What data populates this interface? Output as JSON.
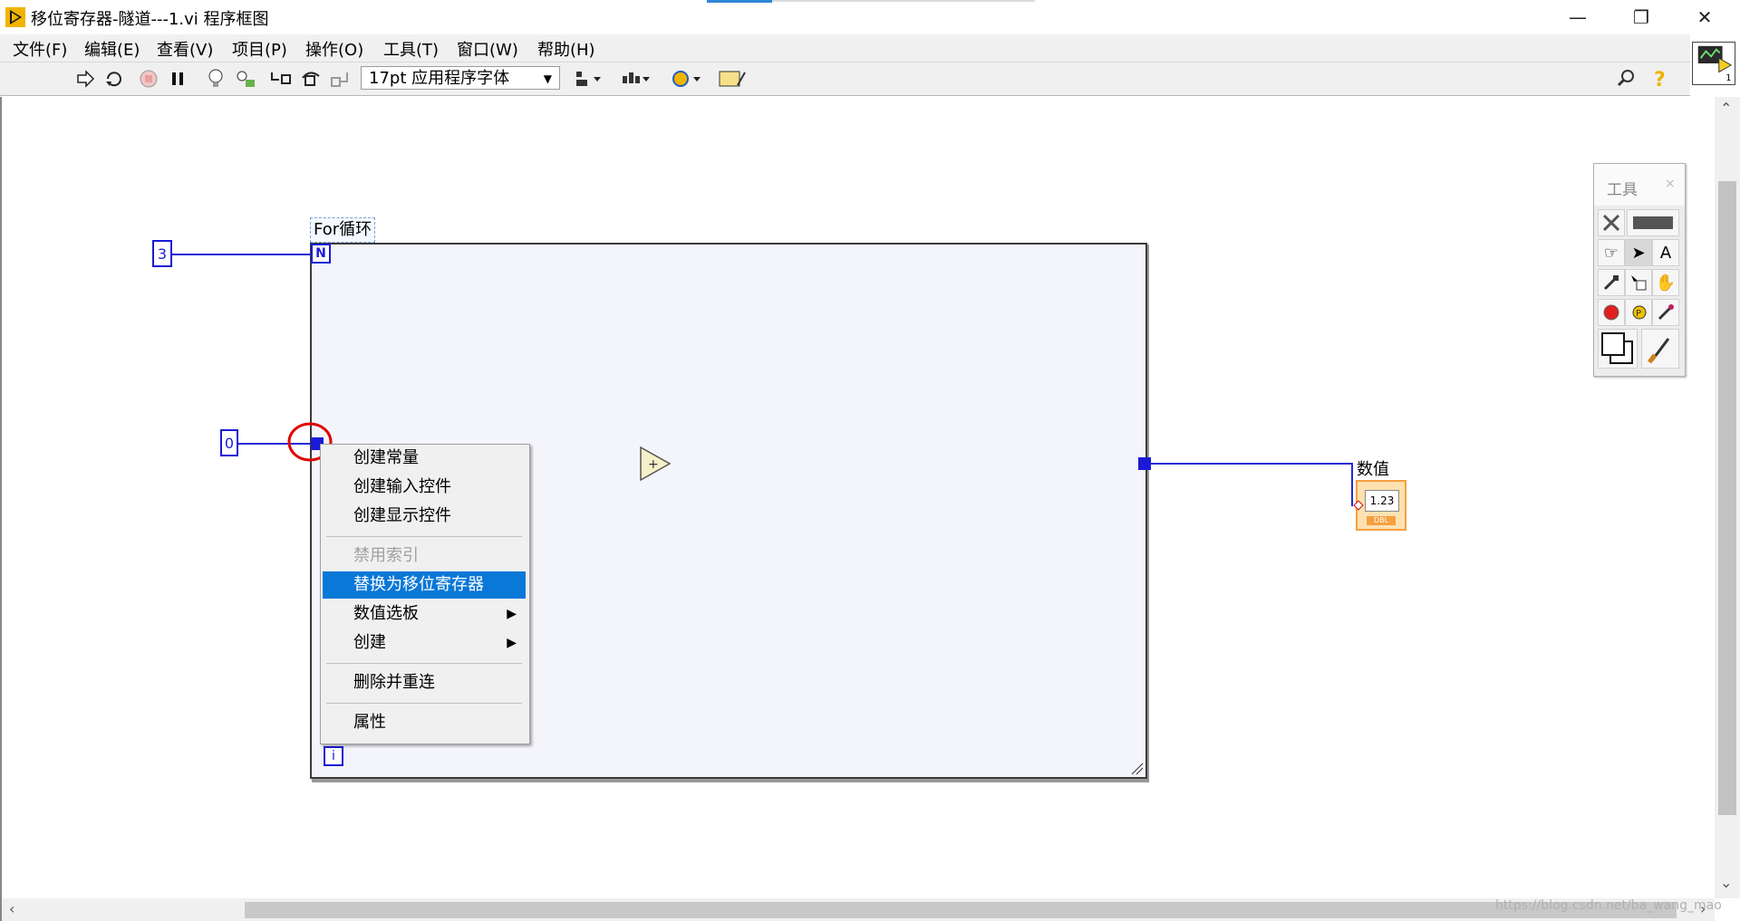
{
  "window": {
    "title": "移位寄存器-隧道---1.vi 程序框图",
    "minimize": "—",
    "maximize": "❐",
    "close": "✕"
  },
  "menu": [
    "文件(F)",
    "编辑(E)",
    "查看(V)",
    "项目(P)",
    "操作(O)",
    "工具(T)",
    "窗口(W)",
    "帮助(H)"
  ],
  "toolbar": {
    "font": "17pt 应用程序字体",
    "font_arrow": "▼"
  },
  "diagram": {
    "loop_count_constant": "3",
    "initial_constant": "0",
    "loop_label": "For循环",
    "loop_count_terminal": "N",
    "iteration_terminal": "i",
    "add_glyph": "+",
    "indicator_label": "数值",
    "indicator_value": "1.23",
    "indicator_type": "DBL"
  },
  "context_menu": {
    "items": [
      {
        "label": "创建常量"
      },
      {
        "label": "创建输入控件"
      },
      {
        "label": "创建显示控件"
      },
      {
        "label": "禁用索引",
        "disabled": true
      },
      {
        "label": "替换为移位寄存器",
        "highlighted": true
      },
      {
        "label": "数值选板",
        "submenu": true
      },
      {
        "label": "创建",
        "submenu": true
      },
      {
        "label": "删除并重连"
      },
      {
        "label": "属性"
      }
    ],
    "submenu_arrow": "▶"
  },
  "tools_palette": {
    "title": "工具",
    "close": "×"
  },
  "scroll": {
    "up": "⌃",
    "down": "⌄",
    "left": "‹",
    "right": "›"
  },
  "watermark": "https://blog.csdn.net/ba_wang_mao",
  "colors": {
    "wire": "#2a2ad8",
    "highlight": "#0a78d7",
    "indicator": "#f4a040",
    "annotation_circle": "#e00000"
  }
}
